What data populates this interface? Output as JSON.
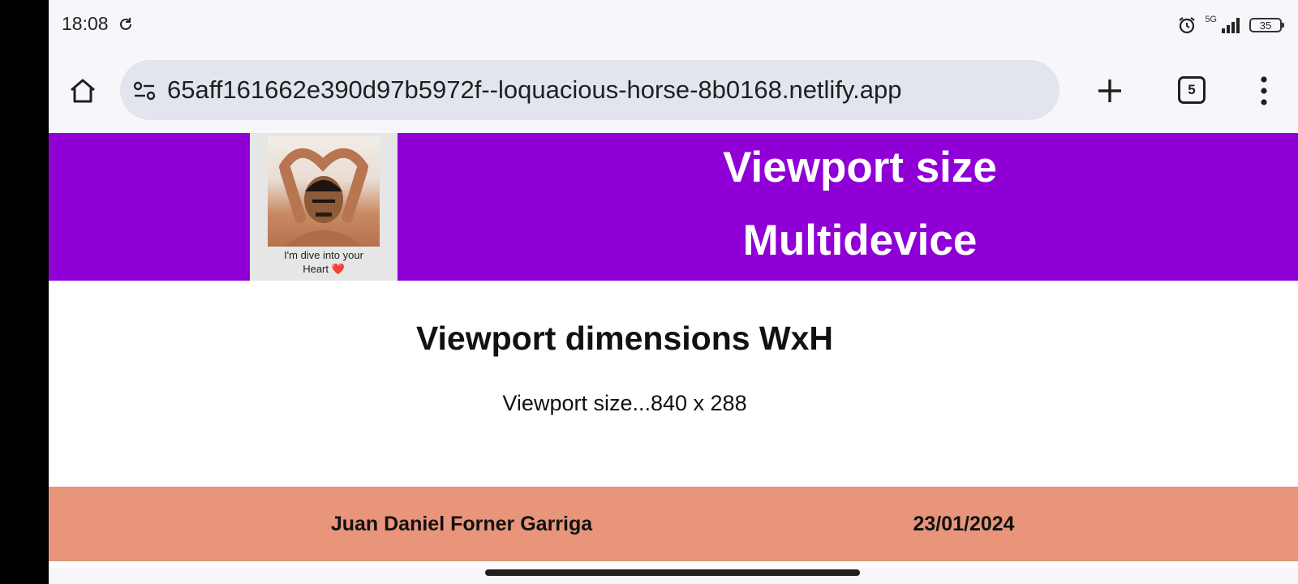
{
  "status_bar": {
    "time": "18:08",
    "sync_icon": "sync-icon",
    "alarm_icon": "alarm-clock-icon",
    "network": "5G",
    "signal_icon": "cellular-signal-icon",
    "battery": "35"
  },
  "browser": {
    "home_icon": "home-icon",
    "site_settings_icon": "site-settings-icon",
    "url": "65aff161662e390d97b5972f--loquacious-horse-8b0168.netlify.app",
    "new_tab_icon": "plus-icon",
    "tab_count": "5",
    "menu_icon": "more-vertical-icon"
  },
  "header": {
    "meme_caption_line1": "I'm dive into your",
    "meme_caption_line2": "Heart ❤️",
    "title_line1": "Viewport size",
    "title_line2": "Multidevice",
    "background_color": "#9000d6"
  },
  "main": {
    "heading": "Viewport dimensions WxH",
    "text": "Viewport size...840 x 288"
  },
  "footer": {
    "name": "Juan Daniel Forner Garriga",
    "date": "23/01/2024",
    "background_color": "#e8957b"
  }
}
